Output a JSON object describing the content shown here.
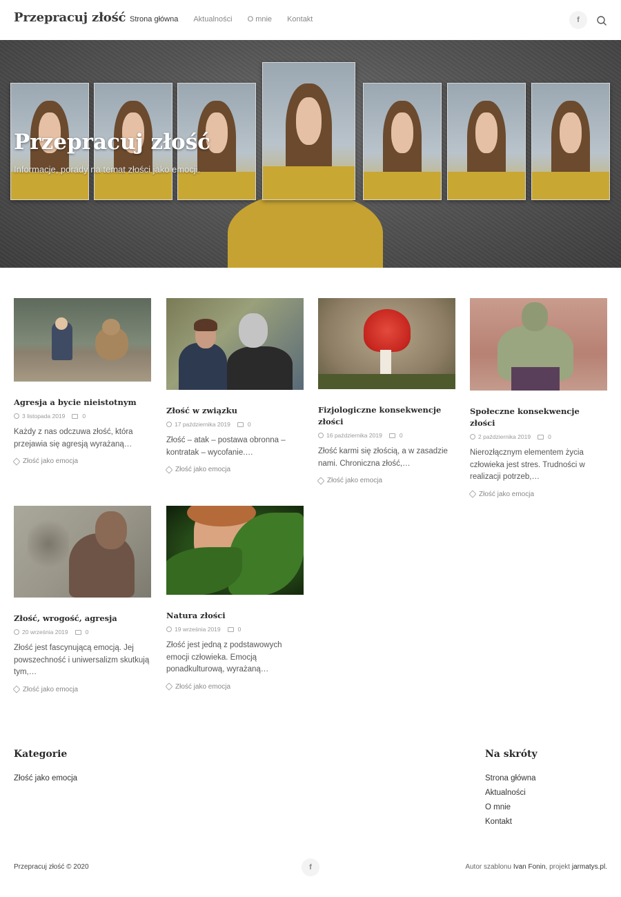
{
  "header": {
    "site_title": "Przepracuj złość",
    "nav": [
      "Strona główna",
      "Aktualności",
      "O mnie",
      "Kontakt"
    ],
    "facebook_icon": "facebook-icon",
    "search_icon": "search-icon"
  },
  "hero": {
    "title": "Przepracuj złość",
    "subtitle": "Informacje, porady na temat złości jako emocji."
  },
  "posts": [
    {
      "title": "Agresja a bycie nieistotnym",
      "date": "3 listopada 2019",
      "comments": "0",
      "excerpt": "Każdy z nas odczuwa złość, która przejawia się agresją wyrażaną…",
      "category": "Złość jako emocja"
    },
    {
      "title": "Złość w związku",
      "date": "17 października 2019",
      "comments": "0",
      "excerpt": "Złość – atak – postawa obronna – kontratak – wycofanie.…",
      "category": "Złość jako emocja"
    },
    {
      "title": "Fizjologiczne konsekwencje złości",
      "date": "16 października 2019",
      "comments": "0",
      "excerpt": "Złość karmi się złością, a w zasadzie nami. Chroniczna złość,…",
      "category": "Złość jako emocja"
    },
    {
      "title": "Społeczne konsekwencje złości",
      "date": "2 października 2019",
      "comments": "0",
      "excerpt": "Nierozłącznym elementem życia człowieka jest stres. Trudności w realizacji potrzeb,…",
      "category": "Złość jako emocja"
    },
    {
      "title": "Złość, wrogość, agresja",
      "date": "20 września 2019",
      "comments": "0",
      "excerpt": "Złość jest fascynującą emocją. Jej powszechność i uniwersalizm skutkują tym,…",
      "category": "Złość jako emocja"
    },
    {
      "title": "Natura złości",
      "date": "19 września 2019",
      "comments": "0",
      "excerpt": "Złość jest jedną z podstawowych emocji człowieka. Emocją ponadkulturową, wyrażaną…",
      "category": "Złość jako emocja"
    }
  ],
  "footer": {
    "categories_heading": "Kategorie",
    "categories": [
      "Złość jako emocja"
    ],
    "shortcuts_heading": "Na skróty",
    "shortcuts": [
      "Strona główna",
      "Aktualności",
      "O mnie",
      "Kontakt"
    ],
    "copyright": "Przepracuj złość © 2020",
    "credit_prefix": "Autor szablonu",
    "credit_author": "Ivan Fonin",
    "credit_mid": ", projekt",
    "credit_site": "jarmatys.pl."
  }
}
